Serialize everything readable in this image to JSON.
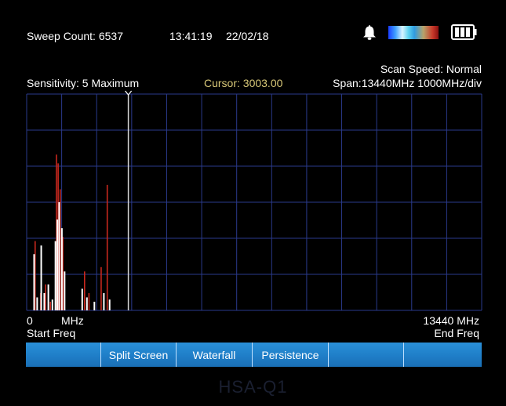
{
  "status": {
    "sweep_count": "Sweep Count: 6537",
    "time": "13:41:19",
    "date": "22/02/18",
    "alarm_icon": "bell-icon",
    "colormap_icon": "color-scale-bar",
    "battery_icon": "battery-icon"
  },
  "info": {
    "scan_speed": "Scan Speed: Normal",
    "sensitivity": "Sensitivity: 5 Maximum",
    "cursor": "Cursor: 3003.00",
    "span": "Span:13440MHz 1000MHz/div"
  },
  "axis": {
    "start_value": "0",
    "unit": "MHz",
    "end_value": "13440 MHz",
    "start_label": "Start Freq",
    "end_label": "End Freq"
  },
  "colors": {
    "grid": "#2a3a8c",
    "trace_white": "#ffffff",
    "trace_red": "#c8281e",
    "cursor_text": "#d8c878",
    "softkey_bar": "#1f7ec8"
  },
  "spectrum": {
    "freq_min": 0,
    "freq_max": 13440,
    "level_max": 100,
    "cursor_freq": 3003.0,
    "peaks_white": [
      {
        "f": 220,
        "h": 26
      },
      {
        "f": 310,
        "h": 6
      },
      {
        "f": 430,
        "h": 30
      },
      {
        "f": 520,
        "h": 8
      },
      {
        "f": 640,
        "h": 12
      },
      {
        "f": 760,
        "h": 5
      },
      {
        "f": 850,
        "h": 32
      },
      {
        "f": 905,
        "h": 42
      },
      {
        "f": 960,
        "h": 50
      },
      {
        "f": 1040,
        "h": 38
      },
      {
        "f": 1120,
        "h": 18
      },
      {
        "f": 1640,
        "h": 10
      },
      {
        "f": 1780,
        "h": 6
      },
      {
        "f": 2000,
        "h": 4
      },
      {
        "f": 2280,
        "h": 8
      },
      {
        "f": 2450,
        "h": 5
      }
    ],
    "peaks_red": [
      {
        "f": 250,
        "h": 32
      },
      {
        "f": 410,
        "h": 8
      },
      {
        "f": 560,
        "h": 12
      },
      {
        "f": 700,
        "h": 4
      },
      {
        "f": 880,
        "h": 72
      },
      {
        "f": 930,
        "h": 68
      },
      {
        "f": 990,
        "h": 56
      },
      {
        "f": 1070,
        "h": 34
      },
      {
        "f": 1710,
        "h": 18
      },
      {
        "f": 1840,
        "h": 8
      },
      {
        "f": 2200,
        "h": 20
      },
      {
        "f": 2380,
        "h": 58
      }
    ]
  },
  "softkeys": [
    "",
    "Split Screen",
    "Waterfall",
    "Persistence",
    "",
    ""
  ],
  "watermark": "HSA-Q1"
}
